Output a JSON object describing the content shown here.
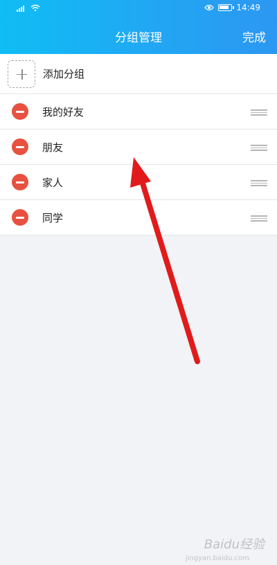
{
  "status_bar": {
    "time": "14:49",
    "icons": [
      "signal-icon",
      "wifi-icon",
      "eye-icon",
      "battery-icon"
    ]
  },
  "header": {
    "title": "分组管理",
    "done_label": "完成",
    "gradient": [
      "#10bdf4",
      "#2c97f2"
    ]
  },
  "add_group": {
    "label": "添加分组",
    "icon": "plus-icon"
  },
  "groups": [
    {
      "label": "我的好友"
    },
    {
      "label": "朋友"
    },
    {
      "label": "家人"
    },
    {
      "label": "同学"
    }
  ],
  "colors": {
    "delete": "#e8513f",
    "arrow": "#e11b1b"
  },
  "watermark": {
    "text": "Baidu经验",
    "sub": "jingyan.baidu.com"
  }
}
